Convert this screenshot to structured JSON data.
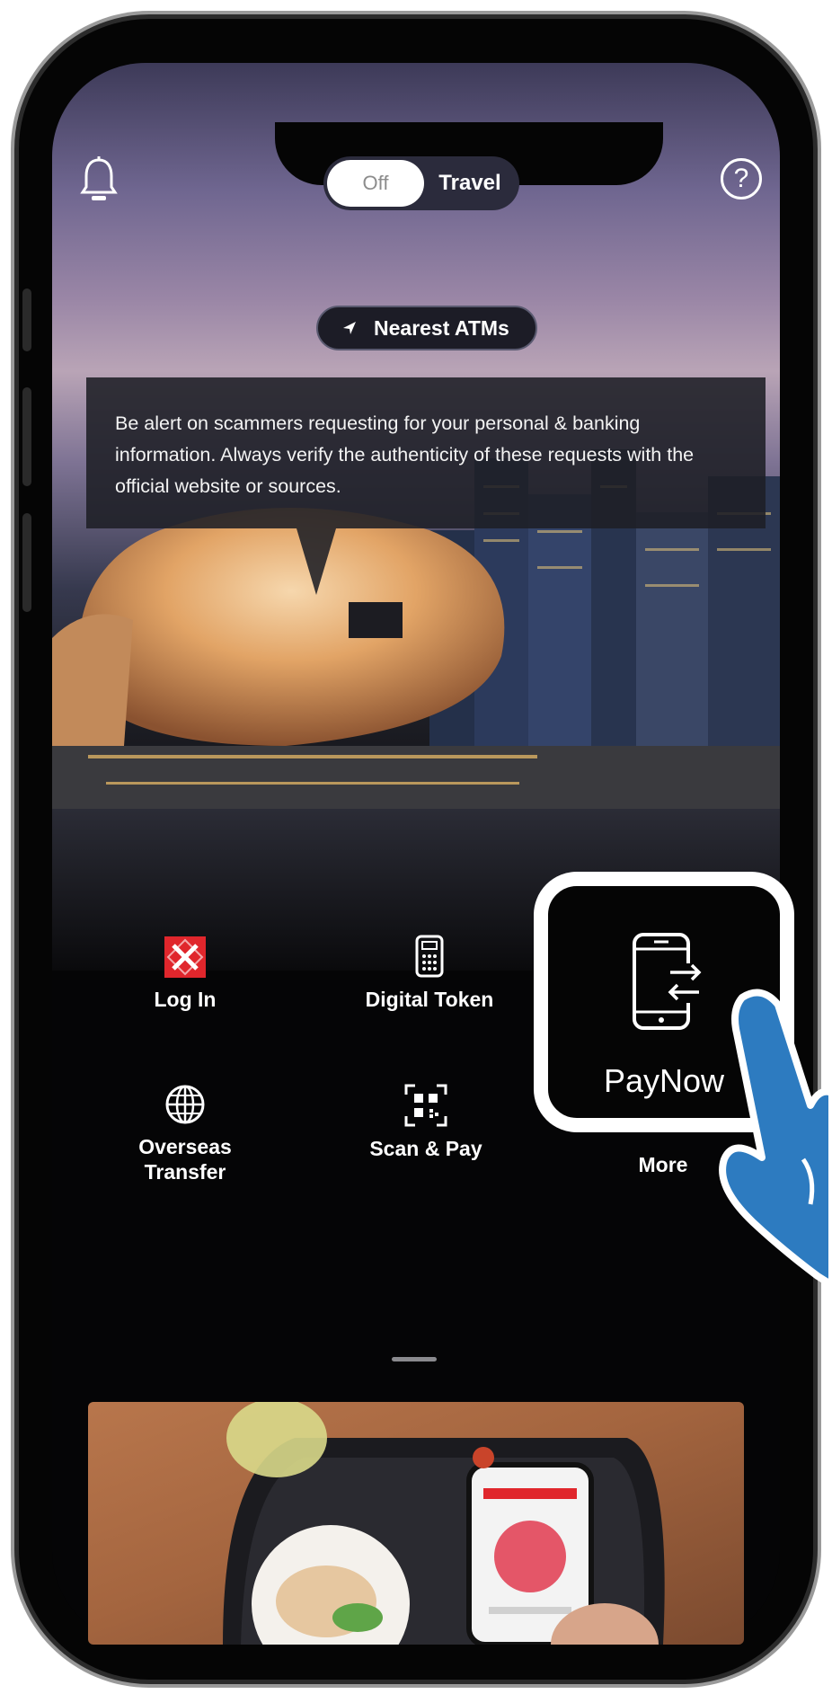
{
  "header": {
    "bell_icon": "bell-icon",
    "help_icon": "help-icon",
    "help_glyph": "?",
    "toggle": {
      "off_label": "Off",
      "travel_label": "Travel",
      "selected": "Off"
    }
  },
  "nearest_atms": {
    "label": "Nearest ATMs",
    "icon": "location-arrow-icon"
  },
  "alert": {
    "text": "Be alert on scammers requesting for your personal & banking information. Always verify the authenticity of these requests with the official website or sources."
  },
  "quick_actions": [
    {
      "label": "Log In",
      "icon": "login-icon"
    },
    {
      "label": "Digital Token",
      "icon": "token-icon"
    },
    {
      "label": "PayNow",
      "icon": "paynow-icon"
    },
    {
      "label_line1": "Overseas",
      "label_line2": "Transfer",
      "icon": "globe-icon"
    },
    {
      "label": "Scan & Pay",
      "icon": "qr-scan-icon"
    },
    {
      "label": "More",
      "icon": ""
    }
  ],
  "colors": {
    "brand_red": "#e0262c",
    "hand_blue": "#2d7bc0",
    "background": "#050506"
  }
}
